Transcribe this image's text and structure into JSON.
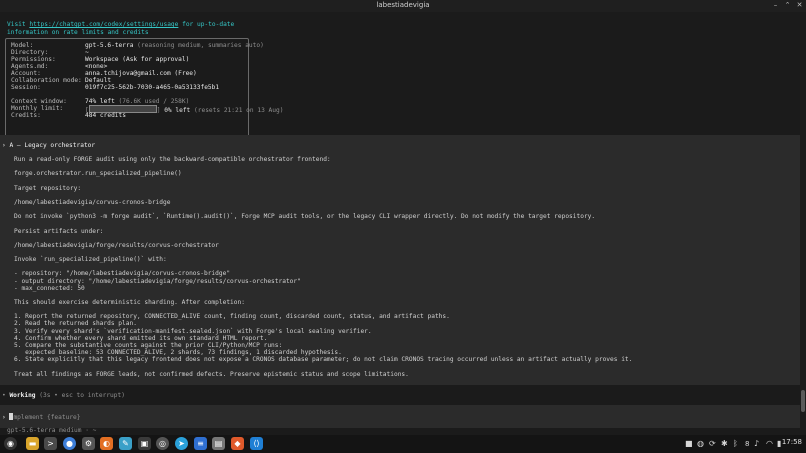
{
  "window": {
    "title": "labestiadevigia"
  },
  "header": {
    "visit_prefix": "Visit ",
    "visit_link": "https://chatgpt.com/codex/settings/usage",
    "visit_suffix": " for up-to-date",
    "visit_line2": "information on rate limits and credits"
  },
  "status": {
    "model_label": "Model:",
    "model_value": "gpt-5.6-terra",
    "model_note": "(reasoning medium, summaries auto)",
    "directory_label": "Directory:",
    "directory_value": "~",
    "permissions_label": "Permissions:",
    "permissions_value": "Workspace (Ask for approval)",
    "agents_label": "Agents.md:",
    "agents_value": "<none>",
    "account_label": "Account:",
    "account_value": "anna.tchijova@gmail.com (Free)",
    "collab_label": "Collaboration mode:",
    "collab_value": "Default",
    "session_label": "Session:",
    "session_value": "019f7c25-562b-7030-a465-0a53133fe5b1",
    "context_label": "Context window:",
    "context_value": "74% left",
    "context_note": "(76.6K used / 258K)",
    "monthly_label": "Monthly limit:",
    "monthly_value": "0% left",
    "monthly_note": "(resets 21:21 on 13 Aug)",
    "monthly_fraction": 0.0,
    "credits_label": "Credits:",
    "credits_value": "484 credits"
  },
  "prompt": {
    "header": "A — Legacy orchestrator",
    "lines": [
      "Run a read-only FORGE audit using only the backward-compatible orchestrator frontend:",
      "",
      "forge.orchestrator.run_specialized_pipeline()",
      "",
      "Target repository:",
      "",
      "/home/labestiadevigia/corvus-cronos-bridge",
      "",
      "Do not invoke `python3 -m forge audit`, `Runtime().audit()`, Forge MCP audit tools, or the legacy CLI wrapper directly. Do not modify the target repository.",
      "",
      "Persist artifacts under:",
      "",
      "/home/labestiadevigia/forge/results/corvus-orchestrator",
      "",
      "Invoke `run_specialized_pipeline()` with:",
      "",
      "- repository: \"/home/labestiadevigia/corvus-cronos-bridge\"",
      "- output directory: \"/home/labestiadevigia/forge/results/corvus-orchestrator\"",
      "- max_connected: 50",
      "",
      "This should exercise deterministic sharding. After completion:",
      "",
      "1. Report the returned repository, CONNECTED_ALIVE count, finding count, discarded count, status, and artifact paths.",
      "2. Read the returned shards plan.",
      "3. Verify every shard's `verification-manifest.sealed.json` with Forge's local sealing verifier.",
      "4. Confirm whether every shard emitted its own standard HTML report.",
      "5. Compare the substantive counts against the prior CLI/Python/MCP runs:",
      "   expected baseline: 53 CONNECTED_ALIVE, 2 shards, 73 findings, 1 discarded hypothesis.",
      "6. State explicitly that this legacy frontend does not expose a CRONOS database parameter; do not claim CRONOS tracing occurred unless an artifact actually proves it.",
      "",
      "Treat all findings as FORGE leads, not confirmed defects. Preserve epistemic status and scope limitations."
    ]
  },
  "working": {
    "label": "Working",
    "note": "(3s • esc to interrupt)"
  },
  "input": {
    "placeholder": "mplement {feature}"
  },
  "footer": {
    "model": "gpt-5.6-terra medium · ~"
  },
  "taskbar": {
    "clock": "17:58",
    "tray_num": "8"
  }
}
